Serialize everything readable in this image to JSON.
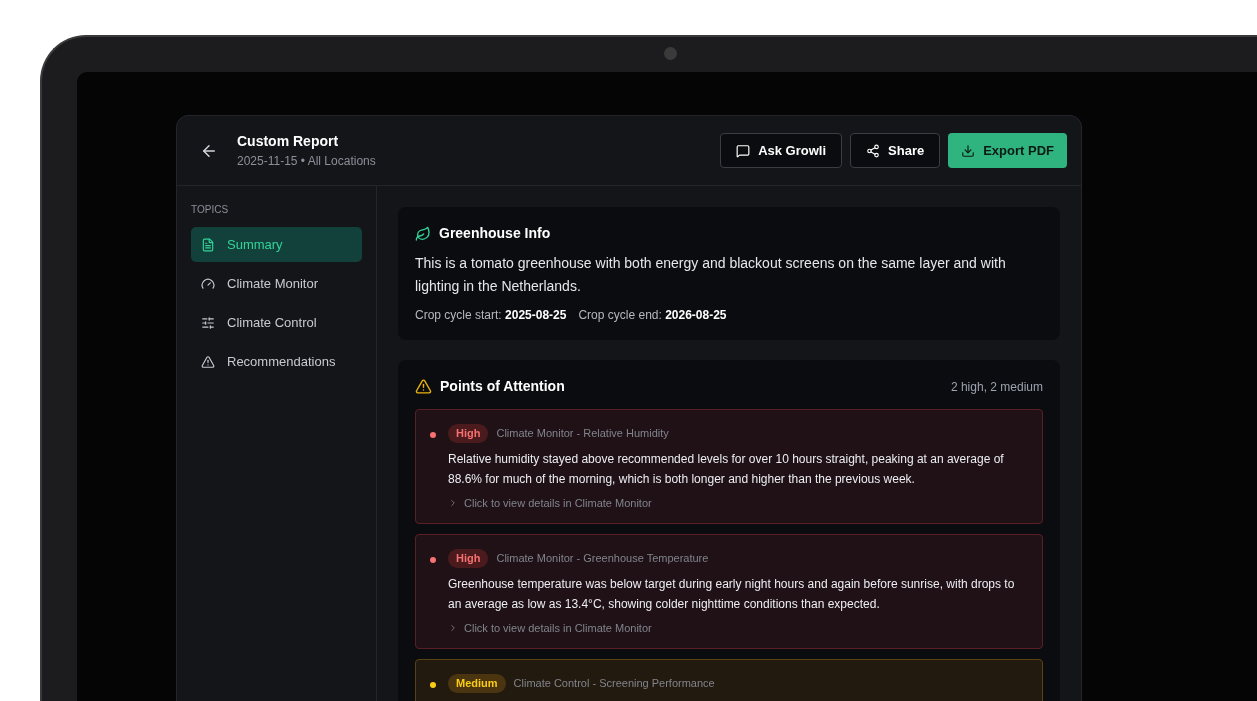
{
  "header": {
    "title": "Custom Report",
    "subtitle": "2025-11-15 • All Locations",
    "buttons": [
      {
        "label": "Ask Growli",
        "kind": "chat",
        "primary": false
      },
      {
        "label": "Share",
        "kind": "share",
        "primary": false
      },
      {
        "label": "Export PDF",
        "kind": "download",
        "primary": true
      }
    ]
  },
  "sidebar": {
    "heading": "TOPICS",
    "items": [
      {
        "label": "Summary",
        "kind": "document",
        "selected": true
      },
      {
        "label": "Climate Monitor",
        "kind": "gauge",
        "selected": false
      },
      {
        "label": "Climate Control",
        "kind": "sliders",
        "selected": false
      },
      {
        "label": "Recommendations",
        "kind": "warning",
        "selected": false
      }
    ]
  },
  "greenhouse_info": {
    "title": "Greenhouse Info",
    "description": "This is a tomato greenhouse with both energy and blackout screens on the same layer and with lighting in the Netherlands.",
    "facts": [
      {
        "label": "Crop cycle start:",
        "value": "2025-08-25"
      },
      {
        "label": "Crop cycle end:",
        "value": "2026-08-25"
      }
    ]
  },
  "points_of_attention": {
    "title": "Points of Attention",
    "count": "2 high, 2 medium",
    "items": [
      {
        "kind": "high",
        "badge": "High",
        "source": "Climate Monitor - Relative Humidity",
        "text": "Relative humidity stayed above recommended levels for over 10 hours straight, peaking at an average of 88.6% for much of the morning, which is both longer and higher than the previous week.",
        "link": "Click to view details in Climate Monitor"
      },
      {
        "kind": "high",
        "badge": "High",
        "source": "Climate Monitor - Greenhouse Temperature",
        "text": "Greenhouse temperature was below target during early night hours and again before sunrise, with drops to an average as low as 13.4°C, showing colder nighttime conditions than expected.",
        "link": "Click to view details in Climate Monitor"
      },
      {
        "kind": "medium",
        "badge": "Medium",
        "source": "Climate Control - Screening Performance"
      }
    ]
  }
}
